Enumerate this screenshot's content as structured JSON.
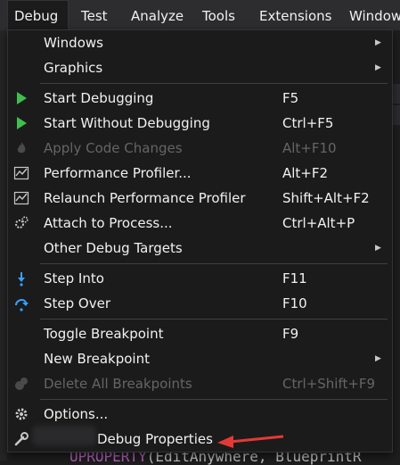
{
  "menubar": {
    "items": [
      {
        "label": "Debug",
        "active": true
      },
      {
        "label": "Test"
      },
      {
        "label": "Analyze"
      },
      {
        "label": "Tools"
      },
      {
        "label": "Extensions"
      },
      {
        "label": "Window"
      }
    ]
  },
  "colors": {
    "menu_bg": "#1b1b1c",
    "menubar_bg": "#2d2d30",
    "text": "#f1f1f1",
    "disabled_text": "#656565",
    "play_green": "#3fbf4f",
    "step_blue": "#36a2ff",
    "annotation_red": "#e53935"
  },
  "menu": {
    "items": [
      {
        "label": "Windows",
        "submenu": true
      },
      {
        "label": "Graphics",
        "submenu": true
      },
      {
        "label": "Start Debugging",
        "shortcut": "F5",
        "icon": "play-icon"
      },
      {
        "label": "Start Without Debugging",
        "shortcut": "Ctrl+F5",
        "icon": "play-outline-icon"
      },
      {
        "label": "Apply Code Changes",
        "shortcut": "Alt+F10",
        "disabled": true,
        "icon": "fire-icon"
      },
      {
        "label": "Performance Profiler...",
        "shortcut": "Alt+F2",
        "icon": "profiler-icon"
      },
      {
        "label": "Relaunch Performance Profiler",
        "shortcut": "Shift+Alt+F2",
        "icon": "profiler-icon"
      },
      {
        "label": "Attach to Process...",
        "shortcut": "Ctrl+Alt+P",
        "icon": "gears-icon"
      },
      {
        "label": "Other Debug Targets",
        "submenu": true
      },
      {
        "label": "Step Into",
        "shortcut": "F11",
        "icon": "step-into-icon"
      },
      {
        "label": "Step Over",
        "shortcut": "F10",
        "icon": "step-over-icon"
      },
      {
        "label": "Toggle Breakpoint",
        "shortcut": "F9"
      },
      {
        "label": "New Breakpoint",
        "submenu": true
      },
      {
        "label": "Delete All Breakpoints",
        "shortcut": "Ctrl+Shift+F9",
        "disabled": true,
        "icon": "delete-breakpoints-icon"
      },
      {
        "label": "Options...",
        "icon": "gear-icon"
      },
      {
        "label": "Debug Properties",
        "icon": "wrench-icon"
      }
    ]
  },
  "code": {
    "keyword": "UPROPERTY",
    "rest": "(EditAnywhere, BlueprintR"
  }
}
